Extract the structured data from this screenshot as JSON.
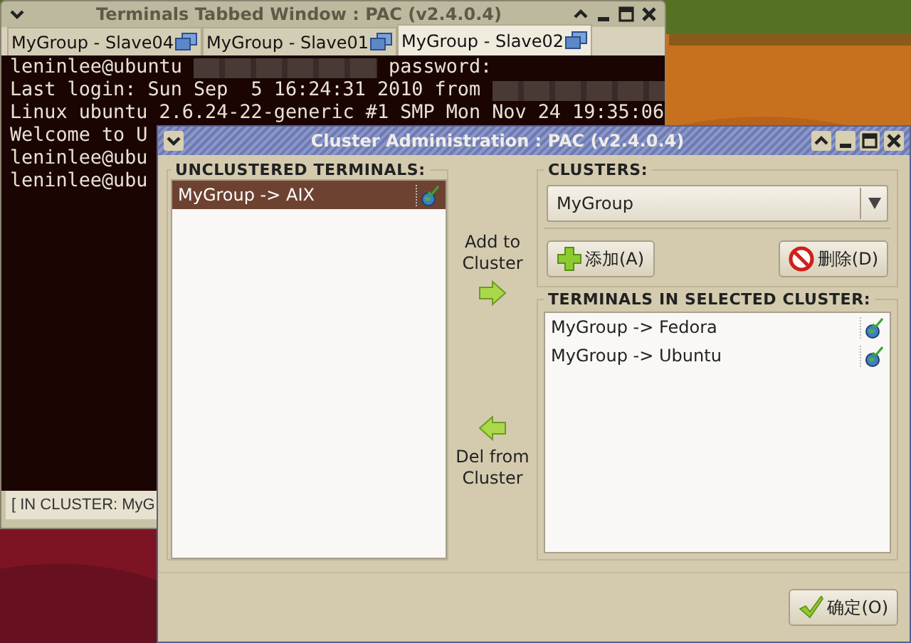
{
  "terminal_window": {
    "title": "Terminals Tabbed Window : PAC (v2.4.0.4)",
    "tabs": [
      {
        "label": "MyGroup - Slave04",
        "selected": false
      },
      {
        "label": "MyGroup - Slave01",
        "selected": false
      },
      {
        "label": "MyGroup - Slave02",
        "selected": true
      }
    ],
    "lines": [
      [
        {
          "kind": "text",
          "text": "leninlee@ubuntu "
        },
        {
          "kind": "redacted"
        },
        {
          "kind": "text",
          "text": " password:"
        }
      ],
      [
        {
          "kind": "text",
          "text": "Last login: Sun Sep  5 16:24:31 2010 from "
        },
        {
          "kind": "redacted"
        }
      ],
      [
        {
          "kind": "text",
          "text": "Linux ubuntu 2.6.24-22-generic #1 SMP Mon Nov 24 19:35:06"
        }
      ],
      [
        {
          "kind": "text",
          "text": "Welcome to U"
        }
      ],
      [
        {
          "kind": "text",
          "text": "leninlee@ubu"
        }
      ],
      [
        {
          "kind": "text",
          "text": "leninlee@ubu"
        }
      ]
    ],
    "status_bar": "[ IN CLUSTER: MyG"
  },
  "dialog": {
    "title": "Cluster Administration : PAC (v2.4.0.4)",
    "unclustered": {
      "heading": "UNCLUSTERED TERMINALS:",
      "items": [
        {
          "label": "MyGroup -> AIX",
          "selected": true
        }
      ]
    },
    "add_label": "Add to Cluster",
    "del_label": "Del from Cluster",
    "clusters": {
      "heading": "CLUSTERS:",
      "value": "MyGroup",
      "add_button": "添加(A)",
      "delete_button": "删除(D)"
    },
    "in_cluster": {
      "heading": "TERMINALS IN SELECTED CLUSTER:",
      "items": [
        {
          "label": "MyGroup -> Fedora",
          "selected": false
        },
        {
          "label": "MyGroup -> Ubuntu",
          "selected": false
        }
      ]
    },
    "ok_button": "确定(O)"
  }
}
